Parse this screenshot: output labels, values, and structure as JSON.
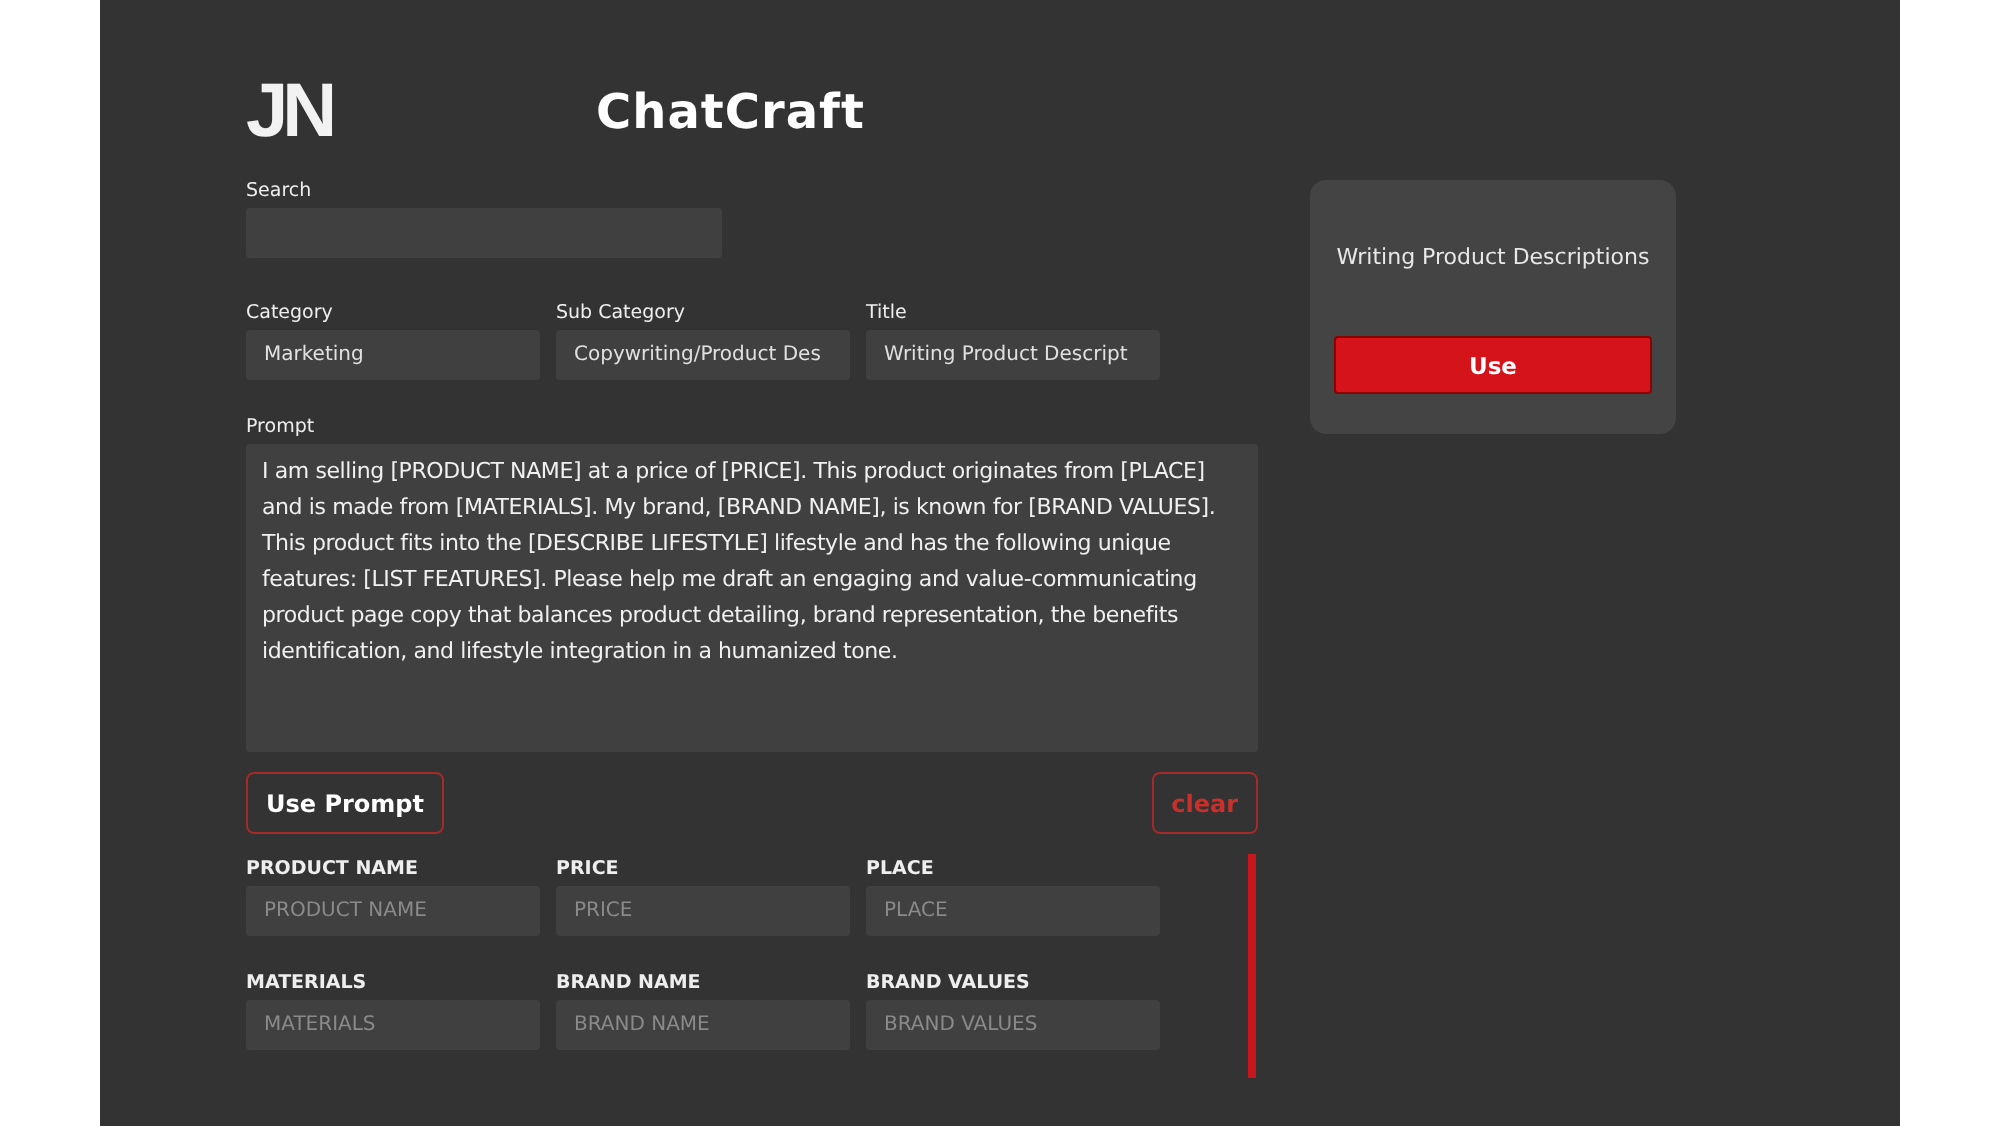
{
  "header": {
    "logo": "JN",
    "title": "ChatCraft"
  },
  "search": {
    "label": "Search"
  },
  "selectors": [
    {
      "label": "Category",
      "value": "Marketing"
    },
    {
      "label": "Sub Category",
      "value": "Copywriting/Product Des"
    },
    {
      "label": "Title",
      "value": "Writing Product Descript"
    }
  ],
  "prompt": {
    "label": "Prompt",
    "value": "I am selling [PRODUCT NAME] at a price of [PRICE]. This product originates from [PLACE] and is made from [MATERIALS]. My brand, [BRAND NAME], is known for [BRAND VALUES]. This product fits into the [DESCRIBE LIFESTYLE] lifestyle and has the following unique features: [LIST FEATURES]. Please help me draft an engaging and value-communicating product page copy that balances product detailing, brand representation, the benefits identification, and lifestyle integration in a humanized tone."
  },
  "actions": {
    "use_prompt": "Use Prompt",
    "clear": "clear"
  },
  "variables": [
    {
      "label": "PRODUCT NAME",
      "placeholder": "PRODUCT NAME"
    },
    {
      "label": "PRICE",
      "placeholder": "PRICE"
    },
    {
      "label": "PLACE",
      "placeholder": "PLACE"
    },
    {
      "label": "MATERIALS",
      "placeholder": "MATERIALS"
    },
    {
      "label": "BRAND NAME",
      "placeholder": "BRAND NAME"
    },
    {
      "label": "BRAND VALUES",
      "placeholder": "BRAND VALUES"
    }
  ],
  "result_card": {
    "title": "Writing Product Descriptions",
    "button": "Use"
  }
}
